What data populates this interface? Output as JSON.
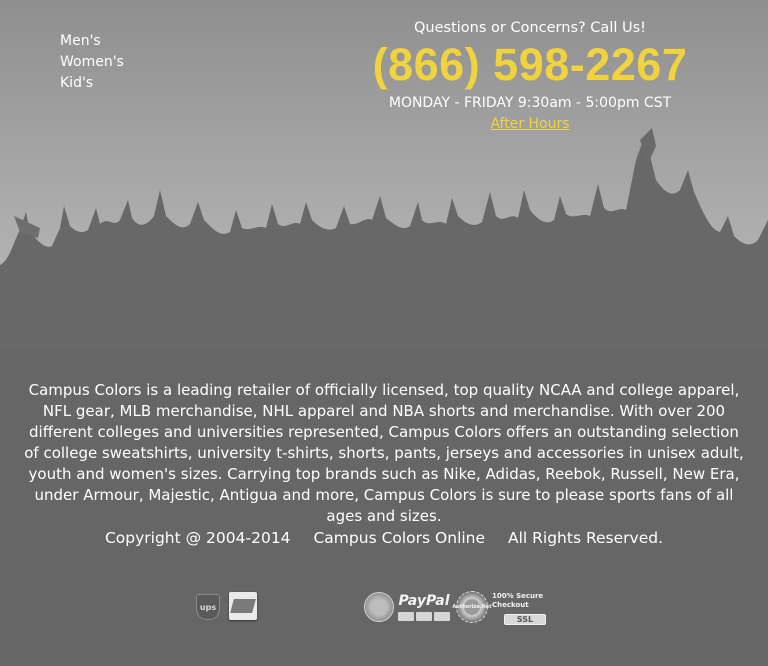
{
  "nav": {
    "items": [
      {
        "label": "Men's"
      },
      {
        "label": "Women's"
      },
      {
        "label": "Kid's"
      }
    ]
  },
  "contact": {
    "question": "Questions or Concerns? Call Us!",
    "phone": "(866) 598-2267",
    "hours": "MONDAY - FRIDAY 9:30am - 5:00pm CST",
    "after_hours": "After Hours"
  },
  "about": {
    "text": "Campus Colors is a leading retailer of officially licensed, top quality NCAA and college apparel, NFL gear, MLB merchandise, NHL apparel and NBA shorts and merchandise. With over 200 different colleges and universities represented, Campus Colors offers an outstanding selection of college sweatshirts, university t-shirts, shorts, pants, jerseys and accessories in unisex adult, youth and women's sizes. Carrying top brands such as Nike, Adidas, Reebok, Russell, New Era, under Armour, Majestic, Antigua and more, Campus Colors is sure to please sports fans of all ages and sizes."
  },
  "footer": {
    "copyright": "Copyright @ 2004-2014",
    "company": "Campus Colors Online",
    "rights": "All Rights Reserved."
  },
  "badges": {
    "ups": "ups",
    "paypal": "PayPal",
    "authnet": "Authorize.Net",
    "secure": "100% Secure Checkout",
    "ssl": "SSL"
  },
  "colors": {
    "accent": "#f0d33e",
    "background": "#666666"
  }
}
